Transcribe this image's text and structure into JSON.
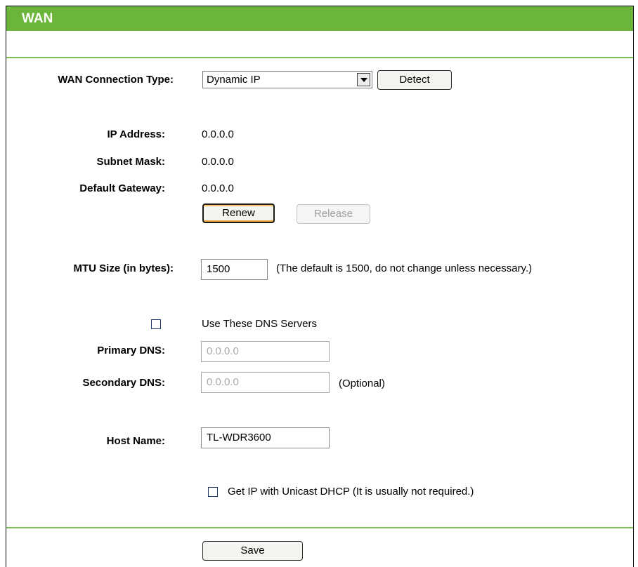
{
  "header": {
    "title": "WAN"
  },
  "wan_connection": {
    "label": "WAN Connection Type:",
    "selected": "Dynamic IP",
    "detect_label": "Detect"
  },
  "status": {
    "ip_label": "IP Address:",
    "ip_value": "0.0.0.0",
    "subnet_label": "Subnet Mask:",
    "subnet_value": "0.0.0.0",
    "gateway_label": "Default Gateway:",
    "gateway_value": "0.0.0.0",
    "renew_label": "Renew",
    "release_label": "Release"
  },
  "mtu": {
    "label": "MTU Size (in bytes):",
    "value": "1500",
    "hint": "(The default is 1500, do not change unless necessary.)"
  },
  "dns": {
    "use_label": "Use These DNS Servers",
    "use_checked": false,
    "primary_label": "Primary DNS:",
    "primary_value": "0.0.0.0",
    "secondary_label": "Secondary DNS:",
    "secondary_value": "0.0.0.0",
    "optional_hint": "(Optional)"
  },
  "host": {
    "label": "Host Name:",
    "value": "TL-WDR3600"
  },
  "unicast": {
    "label": "Get IP with Unicast DHCP (It is usually not required.)",
    "checked": false
  },
  "footer": {
    "save_label": "Save"
  },
  "colors": {
    "header_green": "#6bb53b",
    "divider_green": "#7fbf4f"
  }
}
